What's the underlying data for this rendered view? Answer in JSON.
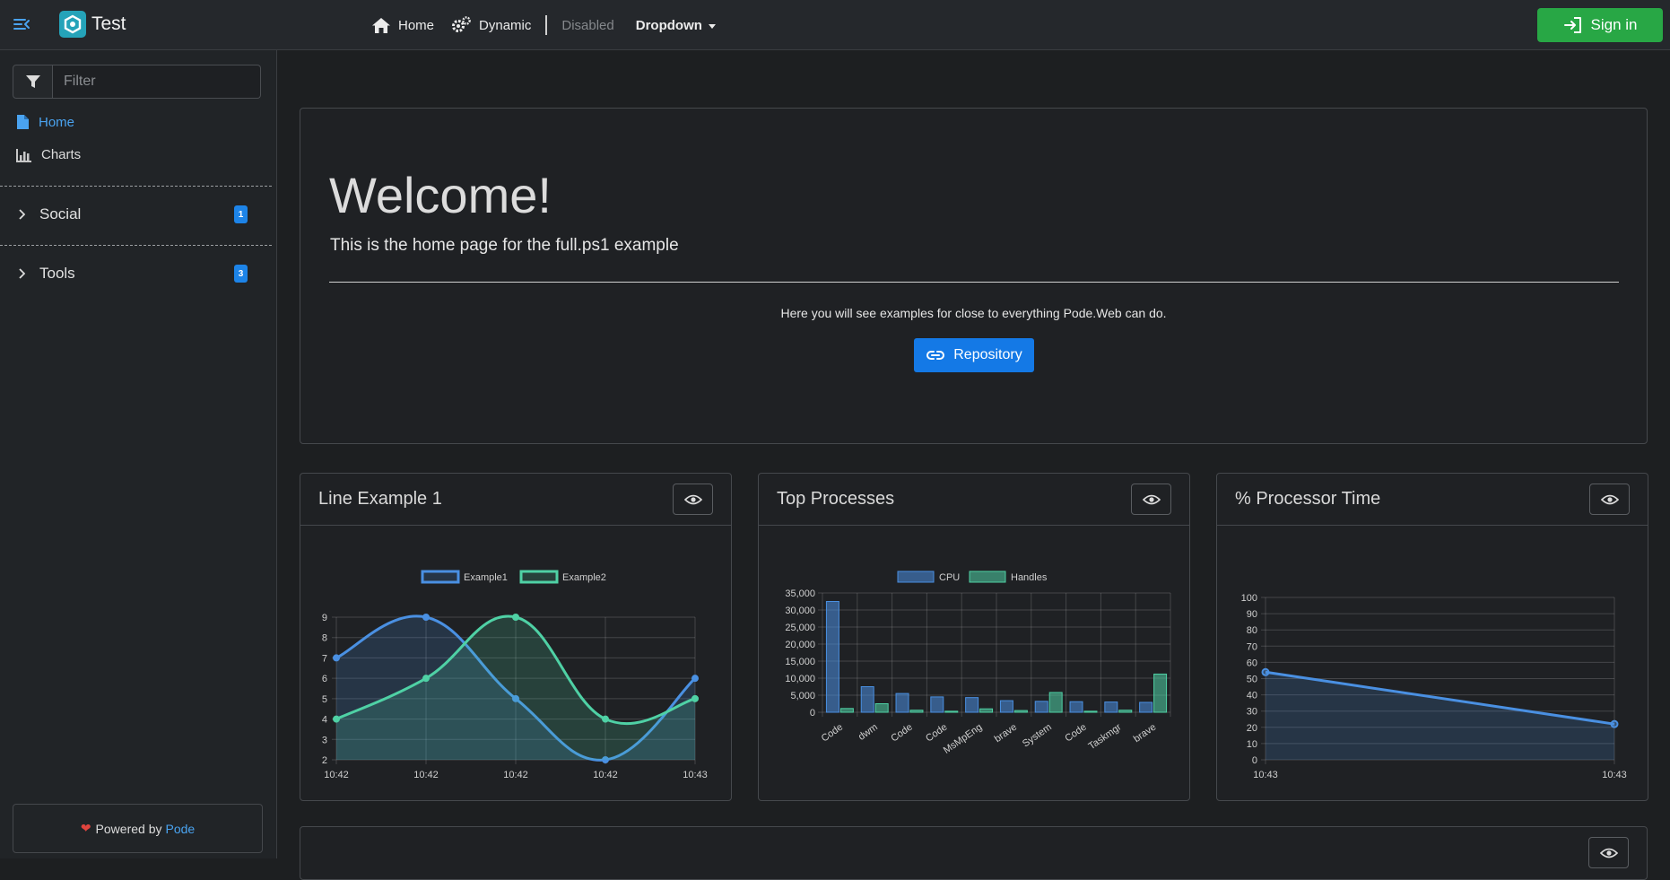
{
  "app": {
    "title": "Test"
  },
  "nav": {
    "home": "Home",
    "dynamic": "Dynamic",
    "disabled": "Disabled",
    "dropdown": "Dropdown",
    "signin": "Sign in"
  },
  "sidebar": {
    "filter_placeholder": "Filter",
    "links": [
      {
        "label": "Home",
        "icon": "file-icon",
        "active": true
      },
      {
        "label": "Charts",
        "icon": "bar-chart-icon",
        "active": false
      }
    ],
    "groups": [
      {
        "label": "Social",
        "badge": "1"
      },
      {
        "label": "Tools",
        "badge": "3"
      }
    ],
    "footer": {
      "prefix": "Powered by",
      "link": "Pode"
    }
  },
  "hero": {
    "title": "Welcome!",
    "subtitle": "This is the home page for the full.ps1 example",
    "text": "Here you will see examples for close to everything Pode.Web can do.",
    "button": "Repository"
  },
  "cards": [
    {
      "title": "Line Example 1"
    },
    {
      "title": "Top Processes"
    },
    {
      "title": "% Processor Time"
    }
  ],
  "colors": {
    "accent": "#4aa3f0",
    "series1": "#4a90e2",
    "series2": "#4fd1a5",
    "signin": "#28a745",
    "repository": "#1479e6",
    "badge": "#1d84e8"
  },
  "chart_data": [
    {
      "type": "line",
      "x": [
        "10:42",
        "10:42",
        "10:42",
        "10:42",
        "10:43"
      ],
      "series": [
        {
          "name": "Example1",
          "values": [
            7,
            9,
            5,
            2,
            6
          ]
        },
        {
          "name": "Example2",
          "values": [
            4,
            6,
            9,
            4,
            5
          ]
        }
      ],
      "ylim": [
        2,
        9
      ],
      "yticks": [
        2,
        3,
        4,
        5,
        6,
        7,
        8,
        9
      ],
      "legend": "top",
      "grid": true,
      "fill": true
    },
    {
      "type": "bar",
      "categories": [
        "Code",
        "dwm",
        "Code",
        "Code",
        "MsMpEng",
        "brave",
        "System",
        "Code",
        "Taskmgr",
        "brave"
      ],
      "series": [
        {
          "name": "CPU",
          "values": [
            32500,
            7500,
            5500,
            4500,
            4300,
            3400,
            3200,
            3100,
            3000,
            2900
          ]
        },
        {
          "name": "Handles",
          "values": [
            1100,
            2500,
            600,
            300,
            1000,
            500,
            5800,
            300,
            600,
            11200
          ]
        }
      ],
      "ylim": [
        0,
        35000
      ],
      "yticks": [
        "0",
        "5,000",
        "10,000",
        "15,000",
        "20,000",
        "25,000",
        "30,000",
        "35,000"
      ],
      "legend": "top",
      "grid": true
    },
    {
      "type": "area",
      "x": [
        "10:43",
        "10:43"
      ],
      "series": [
        {
          "name": "",
          "values": [
            54,
            22
          ]
        }
      ],
      "ylim": [
        0,
        100
      ],
      "yticks": [
        0,
        10,
        20,
        30,
        40,
        50,
        60,
        70,
        80,
        90,
        100
      ],
      "grid": true
    }
  ]
}
